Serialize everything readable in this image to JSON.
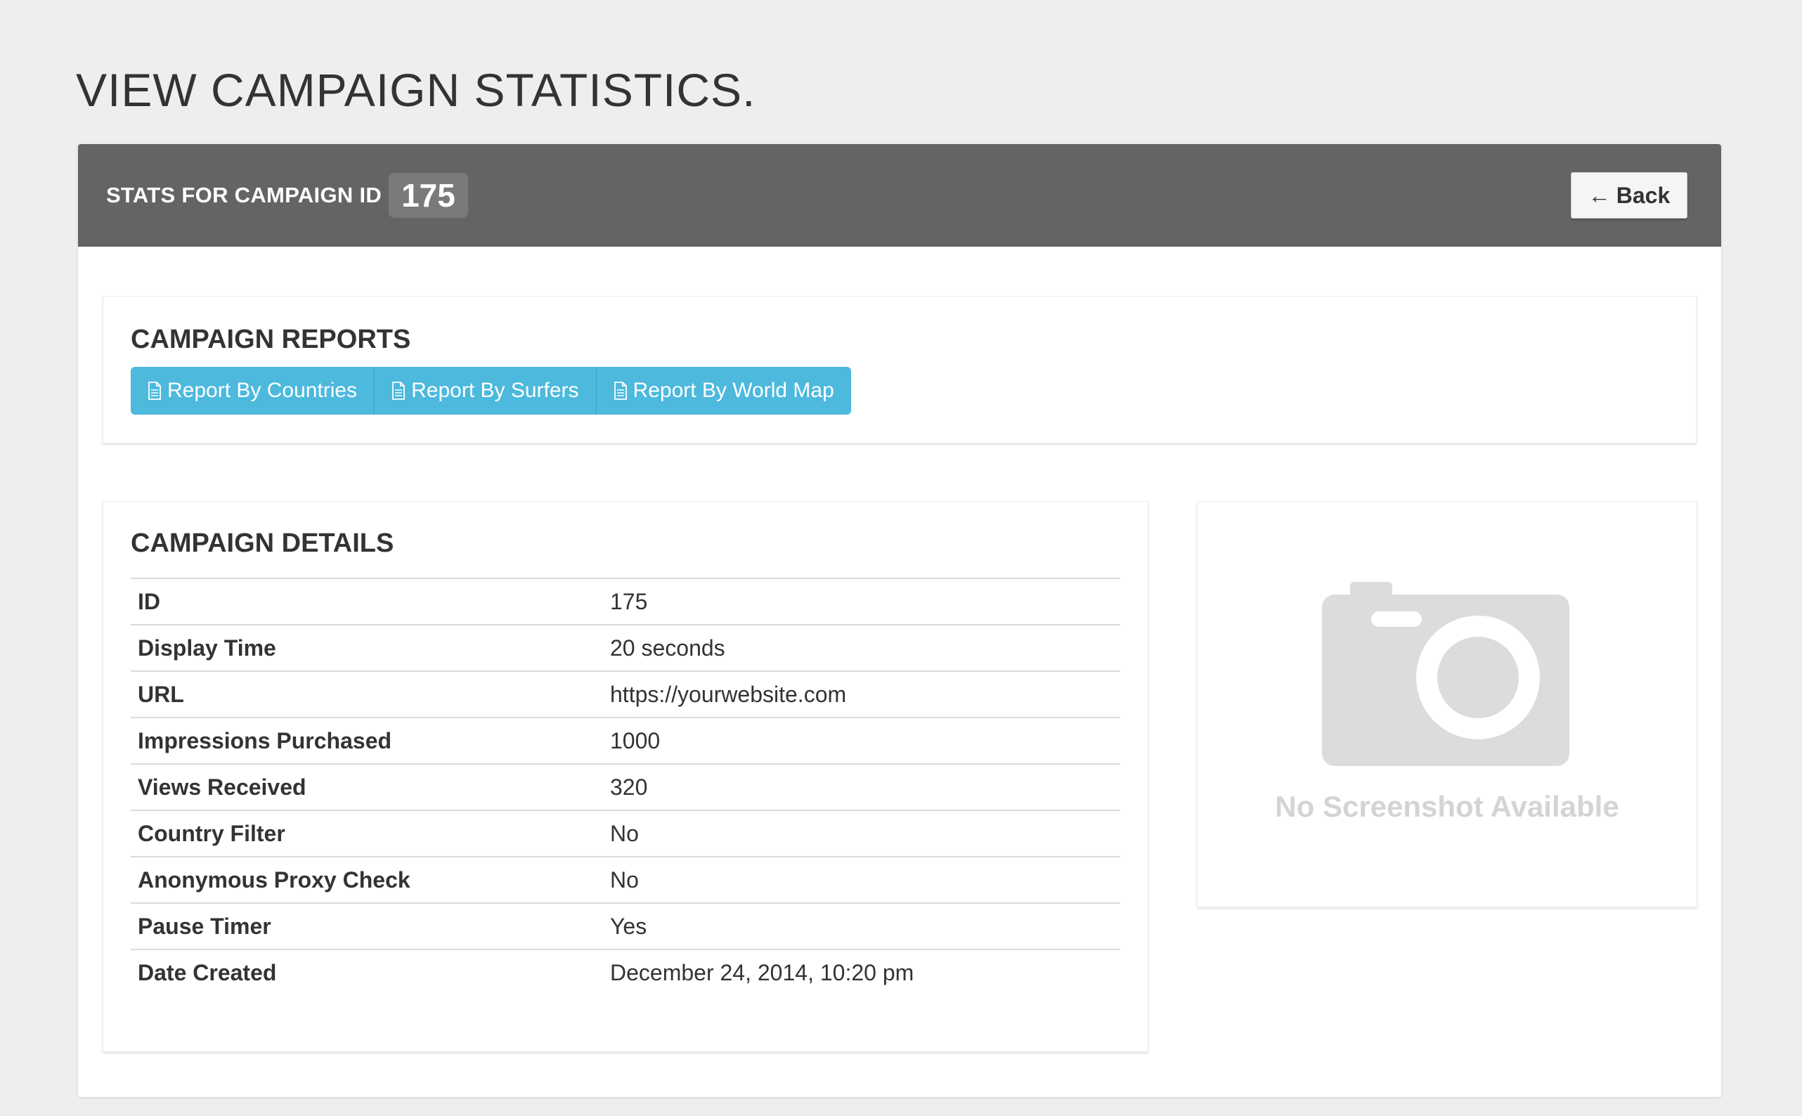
{
  "page": {
    "title": "VIEW CAMPAIGN STATISTICS."
  },
  "header": {
    "label": "STATS FOR CAMPAIGN ID",
    "campaign_id": "175",
    "back_arrow": "←",
    "back_label": "Back"
  },
  "reports": {
    "title": "CAMPAIGN REPORTS",
    "buttons": [
      {
        "label": "Report By Countries",
        "icon": "document-icon"
      },
      {
        "label": "Report By Surfers",
        "icon": "document-icon"
      },
      {
        "label": "Report By World Map",
        "icon": "document-icon"
      }
    ]
  },
  "details": {
    "title": "CAMPAIGN DETAILS",
    "rows": [
      {
        "key": "ID",
        "value": "175"
      },
      {
        "key": "Display Time",
        "value": "20 seconds"
      },
      {
        "key": "URL",
        "value": "https://yourwebsite.com"
      },
      {
        "key": "Impressions Purchased",
        "value": "1000"
      },
      {
        "key": "Views Received",
        "value": "320"
      },
      {
        "key": "Country Filter",
        "value": "No"
      },
      {
        "key": "Anonymous Proxy Check",
        "value": "No"
      },
      {
        "key": "Pause Timer",
        "value": "Yes"
      },
      {
        "key": "Date Created",
        "value": "December 24, 2014, 10:20 pm"
      }
    ]
  },
  "screenshot": {
    "icon": "camera-icon",
    "text": "No Screenshot Available"
  },
  "colors": {
    "background": "#eeeeee",
    "header_bar": "#646464",
    "badge": "#7a7a7a",
    "report_button": "#4cb9dd",
    "placeholder_gray": "#dcdcdc"
  }
}
